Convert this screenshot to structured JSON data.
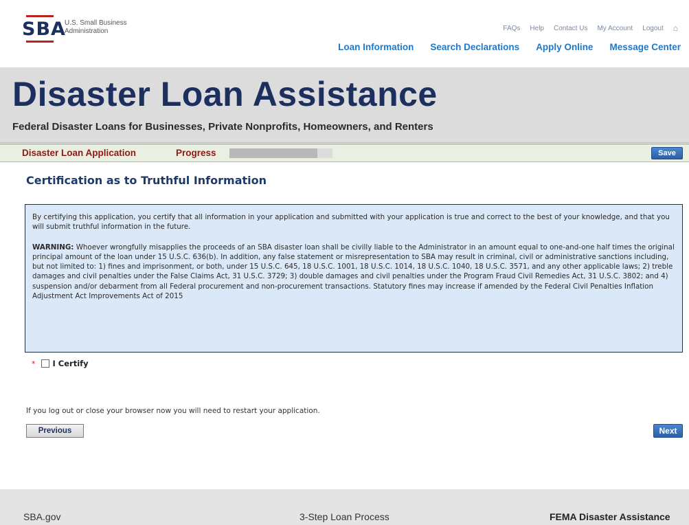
{
  "header": {
    "logo": {
      "mark": "SBA",
      "line1": "U.S. Small Business",
      "line2": "Administration"
    },
    "util_links": [
      "FAQs",
      "Help",
      "Contact Us",
      "My Account",
      "Logout"
    ],
    "main_nav": [
      "Loan Information",
      "Search Declarations",
      "Apply Online",
      "Message Center"
    ]
  },
  "banner": {
    "title": "Disaster Loan Assistance",
    "subtitle": "Federal Disaster Loans for Businesses, Private Nonprofits, Homeowners, and Renters"
  },
  "progress_bar": {
    "title": "Disaster Loan Application",
    "progress_label": "Progress",
    "progress_fraction": 0.85,
    "save_label": "Save"
  },
  "section": {
    "title": "Certification as to Truthful Information",
    "paragraph1": "By certifying this application, you certify that all information in your application and submitted with your application is true and correct to the best of your knowledge, and that you will submit truthful information in the future.",
    "warning_label": "WARNING:",
    "warning_text": " Whoever wrongfully misapplies the proceeds of an SBA disaster loan shall be civilly liable to the Administrator in an amount equal to one-and-one half times the original principal amount of the loan under 15 U.S.C. 636(b). In addition, any false statement or misrepresentation to SBA may result in criminal, civil or administrative sanctions including, but not limited to: 1) fines and imprisonment, or both, under 15 U.S.C. 645, 18 U.S.C. 1001, 18 U.S.C. 1014, 18 U.S.C. 1040, 18 U.S.C. 3571, and any other applicable laws; 2) treble damages and civil penalties under the False Claims Act, 31 U.S.C. 3729; 3) double damages and civil penalties under the Program Fraud Civil Remedies Act, 31 U.S.C. 3802; and 4) suspension and/or debarment from all Federal procurement and non-procurement transactions. Statutory fines may increase if amended by the Federal Civil Penalties Inflation Adjustment Act Improvements Act of 2015",
    "certify_required": "*",
    "certify_label": "I Certify",
    "certify_checked": false
  },
  "logout_note": "If you log out or close your browser now you will need to restart your application.",
  "buttons": {
    "previous": "Previous",
    "next": "Next"
  },
  "footer": {
    "links": [
      "SBA.gov",
      "3-Step Loan Process",
      "FEMA Disaster Assistance"
    ]
  },
  "colors": {
    "navy": "#1d2f5e",
    "link_blue": "#1f78c8",
    "maroon": "#8c1a13",
    "box_bg": "#dbe8f7",
    "button_blue": "#2b5fa8"
  }
}
